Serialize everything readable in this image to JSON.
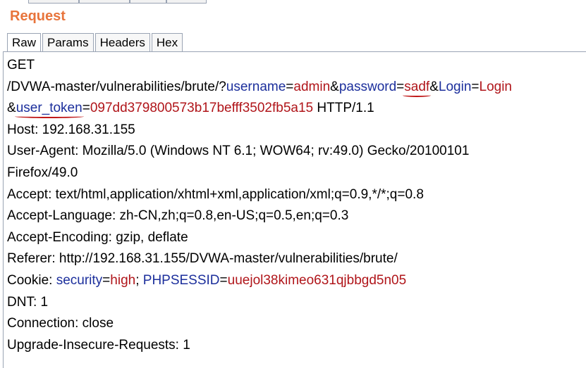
{
  "panel": {
    "title": "Request"
  },
  "tabs": [
    {
      "label": "Raw",
      "active": true
    },
    {
      "label": "Params",
      "active": false
    },
    {
      "label": "Headers",
      "active": false
    },
    {
      "label": "Hex",
      "active": false
    }
  ],
  "request": {
    "method": "GET",
    "path": "/DVWA-master/vulnerabilities/brute/?",
    "params": [
      {
        "key": "username",
        "value": "admin"
      },
      {
        "key": "password",
        "value": "sadf"
      },
      {
        "key": "Login",
        "value": "Login"
      },
      {
        "key": "user_token",
        "value": "097dd379800573b17befff3502fb5a15"
      }
    ],
    "protocol": "HTTP/1.1",
    "host": "Host: 192.168.31.155",
    "user_agent_1": "User-Agent: Mozilla/5.0 (Windows NT 6.1; WOW64; rv:49.0) Gecko/20100101",
    "user_agent_2": "Firefox/49.0",
    "accept": "Accept: text/html,application/xhtml+xml,application/xml;q=0.9,*/*;q=0.8",
    "accept_language": "Accept-Language: zh-CN,zh;q=0.8,en-US;q=0.5,en;q=0.3",
    "accept_encoding": "Accept-Encoding: gzip, deflate",
    "referer": "Referer: http://192.168.31.155/DVWA-master/vulnerabilities/brute/",
    "cookie_label": "Cookie:",
    "cookies": [
      {
        "key": "security",
        "value": "high"
      },
      {
        "key": "PHPSESSID",
        "value": "uuejol38kimeo631qjbbgd5n05"
      }
    ],
    "dnt": "DNT: 1",
    "connection": "Connection: close",
    "upgrade": "Upgrade-Insecure-Requests: 1"
  },
  "colors": {
    "title": "#e8743b",
    "param_key": "#1c2f9c",
    "param_value": "#b0151a",
    "annotation": "#c01818"
  }
}
